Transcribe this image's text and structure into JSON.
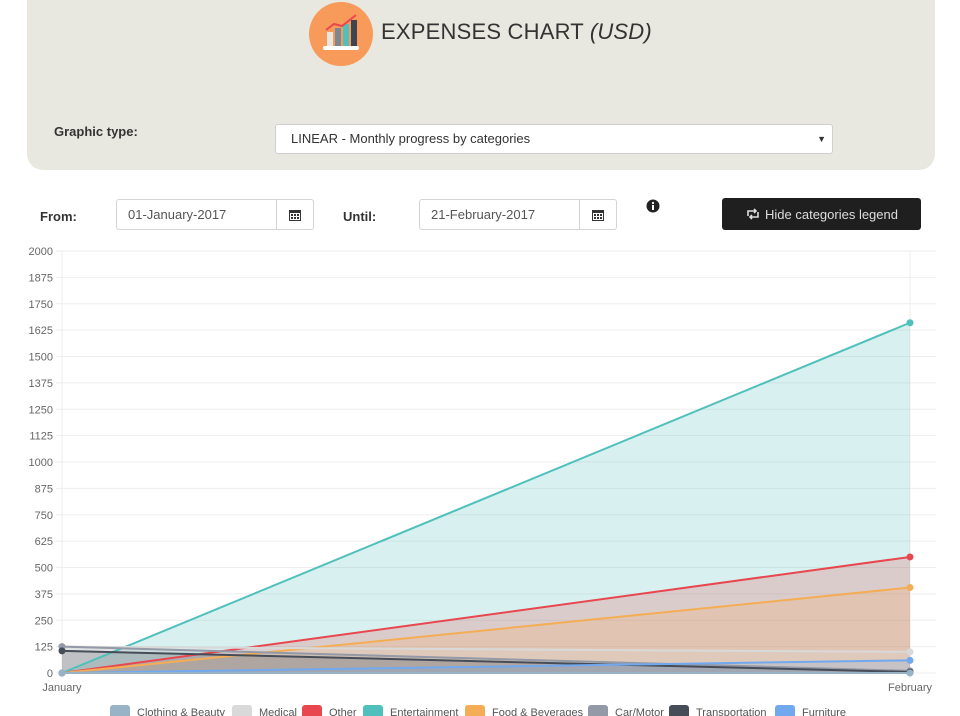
{
  "header": {
    "title": "EXPENSES CHART",
    "title_currency": "(USD)",
    "logo_icon": "bar-chart-icon",
    "logo_color": "#f89a5a"
  },
  "graphic_type": {
    "label": "Graphic type:",
    "selected": "LINEAR - Monthly progress by categories"
  },
  "filters": {
    "from_label": "From:",
    "from_value": "01-January-2017",
    "until_label": "Until:",
    "until_value": "21-February-2017",
    "info_icon": "info-icon",
    "calendar_icon": "calendar-icon"
  },
  "toolbar": {
    "legend_button_label": "Hide categories legend",
    "legend_button_icon": "refresh-icon"
  },
  "chart_data": {
    "type": "area",
    "categories": [
      "January",
      "February"
    ],
    "ylim": [
      0,
      2000
    ],
    "yticks": [
      "0",
      "125",
      "250",
      "375",
      "500",
      "625",
      "750",
      "875",
      "1000",
      "1125",
      "1250",
      "1375",
      "1500",
      "1625",
      "1750",
      "1875",
      "2000"
    ],
    "grid": true,
    "legend": "bottom",
    "series": [
      {
        "name": "Clothing & Beauty",
        "color": "#98b3c6",
        "values": [
          0,
          0
        ]
      },
      {
        "name": "Medical",
        "color": "#d9d9d9",
        "values": [
          125,
          100
        ]
      },
      {
        "name": "Other",
        "color": "#e8474f",
        "values": [
          0,
          550
        ]
      },
      {
        "name": "Entertainment",
        "color": "#4fc0bb",
        "values": [
          0,
          1660
        ]
      },
      {
        "name": "Food & Beverages",
        "color": "#f4ad55",
        "values": [
          0,
          405
        ]
      },
      {
        "name": "Car/Motor",
        "color": "#9399a6",
        "values": [
          125,
          10
        ]
      },
      {
        "name": "Transportation",
        "color": "#474d58",
        "values": [
          105,
          5
        ]
      },
      {
        "name": "Furniture",
        "color": "#72a8ee",
        "values": [
          0,
          60
        ]
      }
    ]
  }
}
